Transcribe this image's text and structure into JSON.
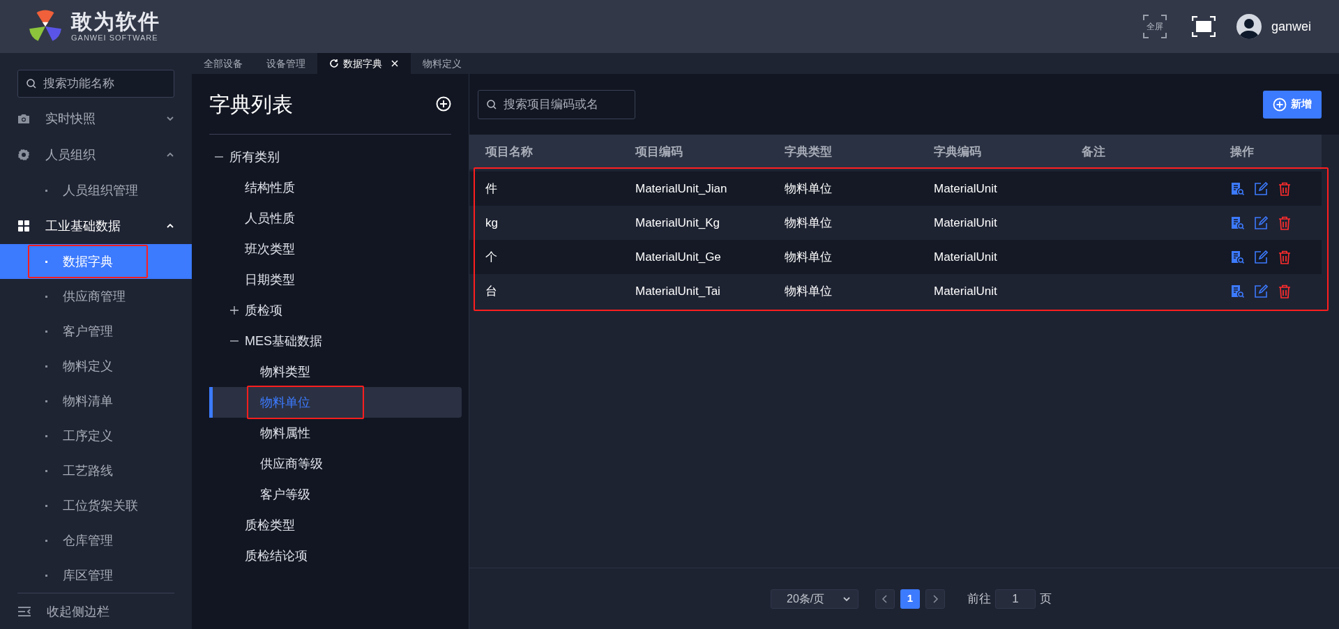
{
  "header": {
    "brand": "敢为软件",
    "brand_subtitle": "GANWEI SOFTWARE",
    "fullscreen_label": "全屏",
    "user": "ganwei"
  },
  "tabs": [
    {
      "label": "全部设备",
      "selected": false
    },
    {
      "label": "设备管理",
      "selected": false
    },
    {
      "label": "数据字典",
      "selected": true
    },
    {
      "label": "物料定义",
      "selected": false
    }
  ],
  "sidebar": {
    "search": {
      "placeholder": "搜索功能名称"
    },
    "items": [
      {
        "label": "实时快照",
        "expanded": false
      },
      {
        "label": "人员组织",
        "expanded": true,
        "children": [
          {
            "label": "人员组织管理",
            "selected": false,
            "highlighted": false
          }
        ]
      },
      {
        "label": "工业基础数据",
        "expanded": true,
        "children": [
          {
            "label": "数据字典",
            "selected": true,
            "highlighted": true
          },
          {
            "label": "供应商管理",
            "selected": false,
            "highlighted": false
          },
          {
            "label": "客户管理",
            "selected": false,
            "highlighted": false
          },
          {
            "label": "物料定义",
            "selected": false,
            "highlighted": false
          },
          {
            "label": "物料清单",
            "selected": false,
            "highlighted": false
          },
          {
            "label": "工序定义",
            "selected": false,
            "highlighted": false
          },
          {
            "label": "工艺路线",
            "selected": false,
            "highlighted": false
          },
          {
            "label": "工位货架关联",
            "selected": false,
            "highlighted": false
          },
          {
            "label": "仓库管理",
            "selected": false,
            "highlighted": false
          },
          {
            "label": "库区管理",
            "selected": false,
            "highlighted": false
          }
        ]
      }
    ],
    "collapse_label": "收起侧边栏"
  },
  "dictionary_tree": {
    "title": "字典列表",
    "nodes": [
      {
        "label": "所有类别",
        "expanded": true,
        "selected": false,
        "highlighted": false,
        "children": [
          {
            "label": "结构性质",
            "selected": false,
            "highlighted": false
          },
          {
            "label": "人员性质",
            "selected": false,
            "highlighted": false
          },
          {
            "label": "班次类型",
            "selected": false,
            "highlighted": false
          },
          {
            "label": "日期类型",
            "selected": false,
            "highlighted": false
          },
          {
            "label": "质检项",
            "expanded": false,
            "selected": false,
            "highlighted": false
          },
          {
            "label": "MES基础数据",
            "expanded": true,
            "selected": false,
            "highlighted": false,
            "children": [
              {
                "label": "物料类型",
                "selected": false,
                "highlighted": false
              },
              {
                "label": "物料单位",
                "selected": true,
                "highlighted": true
              },
              {
                "label": "物料属性",
                "selected": false,
                "highlighted": false
              },
              {
                "label": "供应商等级",
                "selected": false,
                "highlighted": false
              },
              {
                "label": "客户等级",
                "selected": false,
                "highlighted": false
              }
            ]
          },
          {
            "label": "质检类型",
            "selected": false,
            "highlighted": false
          },
          {
            "label": "质检结论项",
            "selected": false,
            "highlighted": false
          }
        ]
      }
    ]
  },
  "toolbar": {
    "search": {
      "placeholder": "搜索项目编码或名"
    },
    "add_button": "新增"
  },
  "table": {
    "columns": [
      "项目名称",
      "项目编码",
      "字典类型",
      "字典编码",
      "备注",
      "操作"
    ],
    "highlighted": true,
    "rows": [
      [
        "件",
        "MaterialUnit_Jian",
        "物料单位",
        "MaterialUnit",
        ""
      ],
      [
        "kg",
        "MaterialUnit_Kg",
        "物料单位",
        "MaterialUnit",
        ""
      ],
      [
        "个",
        "MaterialUnit_Ge",
        "物料单位",
        "MaterialUnit",
        ""
      ],
      [
        "台",
        "MaterialUnit_Tai",
        "物料单位",
        "MaterialUnit",
        ""
      ]
    ]
  },
  "pagination": {
    "page_size": "20条/页",
    "pages": [
      {
        "label": "1",
        "selected": true
      }
    ],
    "goto_label": "前往",
    "goto_value": "1",
    "page_suffix": "页"
  }
}
